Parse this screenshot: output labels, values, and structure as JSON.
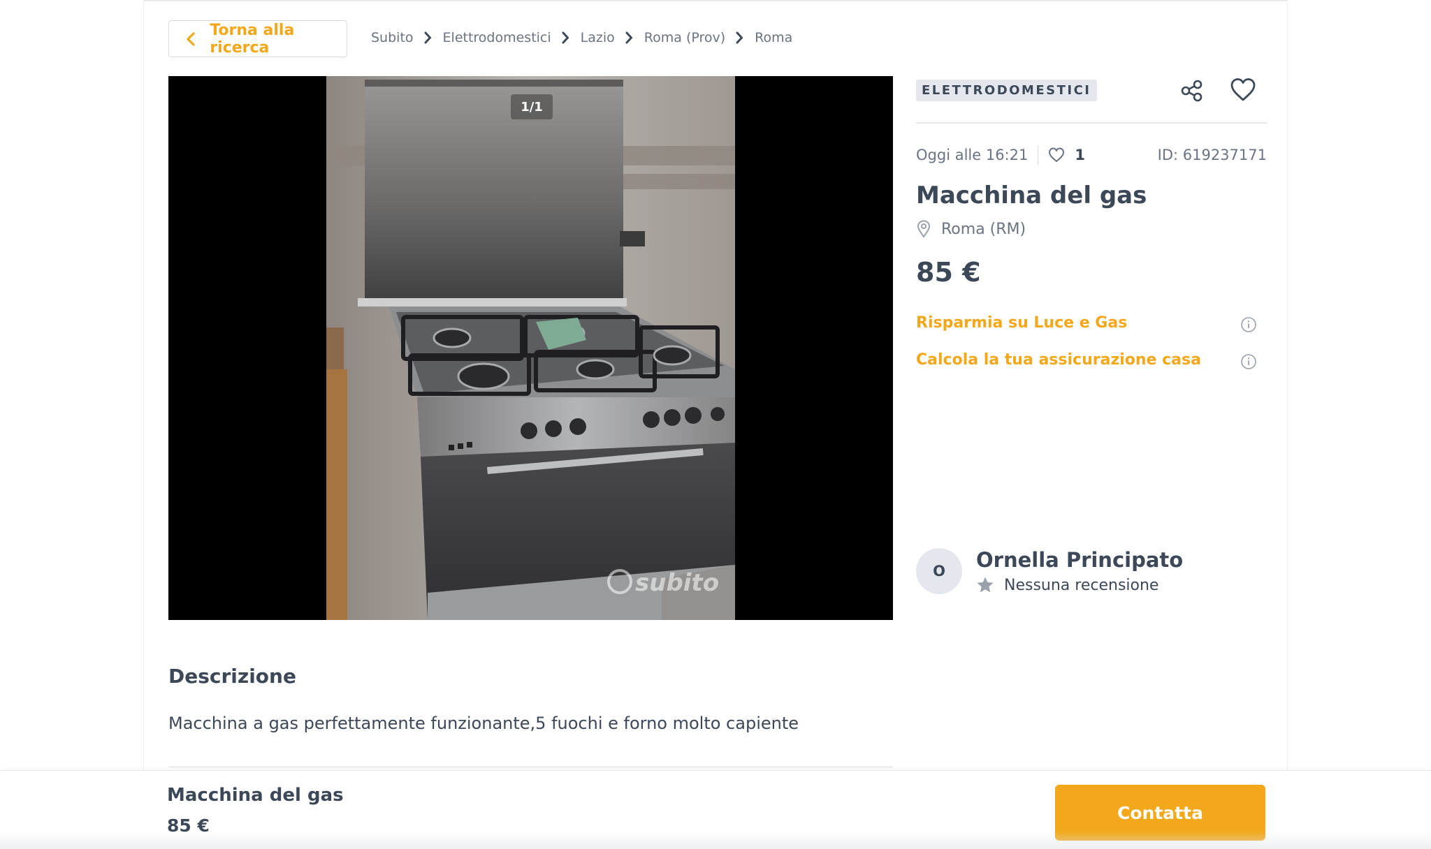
{
  "header": {
    "back_label": "Torna alla ricerca",
    "breadcrumb": [
      "Subito",
      "Elettrodomestici",
      "Lazio",
      "Roma (Prov)",
      "Roma"
    ]
  },
  "gallery": {
    "counter": "1/1",
    "watermark": "subito"
  },
  "listing": {
    "category": "ELETTRODOMESTICI",
    "date": "Oggi alle 16:21",
    "favorites_count": "1",
    "ad_id": "ID: 619237171",
    "title": "Macchina del gas",
    "location": "Roma (RM)",
    "price": "85 €",
    "promos": [
      "Risparmia su Luce e Gas",
      "Calcola la tua assicurazione casa"
    ]
  },
  "seller": {
    "initial": "O",
    "name": "Ornella Principato",
    "reviews": "Nessuna recensione"
  },
  "description": {
    "heading": "Descrizione",
    "text": "Macchina a gas perfettamente funzionante,5 fuochi e forno molto capiente"
  },
  "sticky_bar": {
    "title": "Macchina del gas",
    "price": "85 €",
    "contact_label": "Contatta"
  },
  "colors": {
    "accent": "#f3a81b",
    "text": "#3c4858",
    "muted": "#6b7482",
    "badge_bg": "#e4e7ed"
  },
  "icons": [
    "chevron-left-icon",
    "chevron-right-icon",
    "share-icon",
    "heart-icon",
    "map-pin-icon",
    "info-icon",
    "star-icon"
  ]
}
